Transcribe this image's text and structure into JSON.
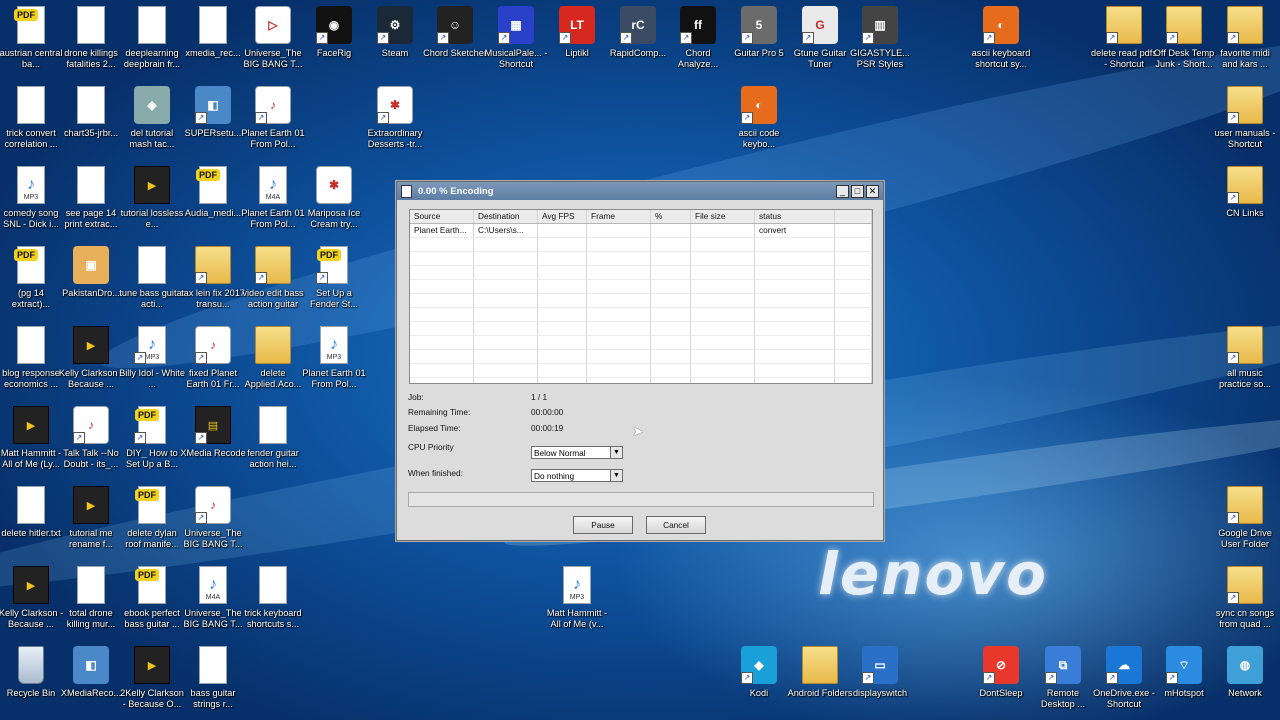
{
  "desktop": {
    "brand": "lenovo",
    "icons": [
      {
        "label": "austrian central ba...",
        "icon": "pdf-icon",
        "shortcut": false
      },
      {
        "label": "drone killings fatalities 2...",
        "icon": "document-icon",
        "shortcut": false
      },
      {
        "label": "deeplearning deepbrain fr...",
        "icon": "document-icon",
        "shortcut": false
      },
      {
        "label": "xmedia_rec...",
        "icon": "document-icon",
        "shortcut": false
      },
      {
        "label": "Universe_The BIG BANG T...",
        "icon": "media-player-icon",
        "shortcut": false
      },
      {
        "label": "FaceRig",
        "icon": "facerig-icon",
        "shortcut": true
      },
      {
        "label": "Steam",
        "icon": "steam-icon",
        "shortcut": true
      },
      {
        "label": "Chord Sketcher",
        "icon": "chord-sketcher-icon",
        "shortcut": true
      },
      {
        "label": "MusicalPale... - Shortcut",
        "icon": "musical-palette-icon",
        "shortcut": true
      },
      {
        "label": "Liptikl",
        "icon": "liptikl-icon",
        "shortcut": true
      },
      {
        "label": "RapidComp...",
        "icon": "rapidcomposer-icon",
        "shortcut": true
      },
      {
        "label": "Chord Analyze...",
        "icon": "chord-analyzer-icon",
        "shortcut": true
      },
      {
        "label": "Guitar Pro 5",
        "icon": "guitar-pro-icon",
        "shortcut": true
      },
      {
        "label": "Gtune Guitar Tuner",
        "icon": "gtune-icon",
        "shortcut": true
      },
      {
        "label": "GIGASTYLE... PSR Styles",
        "icon": "keyboard-icon",
        "shortcut": true
      },
      {
        "label": "ascii keyboard shortcut sy...",
        "icon": "firefox-icon",
        "shortcut": true
      },
      {
        "label": "delete read pdfs - Shortcut",
        "icon": "folder-icon",
        "shortcut": true
      },
      {
        "label": "Off Desk Temp Junk - Short...",
        "icon": "folder-icon",
        "shortcut": true
      },
      {
        "label": "favorite midi and kars ...",
        "icon": "folder-icon",
        "shortcut": true
      },
      {
        "label": "trick convert correlation ...",
        "icon": "document-icon",
        "shortcut": false
      },
      {
        "label": "chart35-jrbr...",
        "icon": "document-icon",
        "shortcut": false
      },
      {
        "label": "del tutorial mash tac...",
        "icon": "app-icon",
        "shortcut": false
      },
      {
        "label": "SUPERsetu...",
        "icon": "setup-icon",
        "shortcut": true
      },
      {
        "label": "Planet Earth 01 From Pol...",
        "icon": "media-file-icon",
        "shortcut": true
      },
      {
        "label": "Extraordinary Desserts -tr...",
        "icon": "yelp-icon",
        "shortcut": true
      },
      {
        "label": "ascii code keybo...",
        "icon": "firefox-icon",
        "shortcut": true
      },
      {
        "label": "user manuals - Shortcut",
        "icon": "folder-icon",
        "shortcut": true
      },
      {
        "label": "comedy song SNL - Dick i...",
        "icon": "mp3-icon",
        "shortcut": false
      },
      {
        "label": "see page 14 print extrac...",
        "icon": "document-icon",
        "shortcut": false
      },
      {
        "label": "tutorial lossless e...",
        "icon": "video-icon",
        "shortcut": false
      },
      {
        "label": "Audia_medi...",
        "icon": "pdf-icon",
        "shortcut": false
      },
      {
        "label": "Planet Earth 01 From Pol...",
        "icon": "m4a-icon",
        "shortcut": false
      },
      {
        "label": "Mariposa Ice Cream try...",
        "icon": "yelp-icon",
        "shortcut": false
      },
      {
        "label": "CN Links",
        "icon": "folder-icon",
        "shortcut": true
      },
      {
        "label": "(pg 14 extract)...",
        "icon": "pdf-icon",
        "shortcut": false
      },
      {
        "label": "PakistanDro...",
        "icon": "image-icon",
        "shortcut": false
      },
      {
        "label": "tune bass guitar acti...",
        "icon": "document-icon",
        "shortcut": false
      },
      {
        "label": "tax lein fix 2017 transu...",
        "icon": "folder-icon",
        "shortcut": true
      },
      {
        "label": "video edit bass action guitar",
        "icon": "folder-icon",
        "shortcut": true
      },
      {
        "label": "Set Up a Fender St...",
        "icon": "pdf-icon",
        "shortcut": true
      },
      {
        "label": "blog response economics ...",
        "icon": "document-icon",
        "shortcut": false
      },
      {
        "label": "Kelly Clarkson - Because ...",
        "icon": "video-icon",
        "shortcut": false
      },
      {
        "label": "Billy Idol - White ...",
        "icon": "mp3-icon",
        "shortcut": true
      },
      {
        "label": "fixed Planet Earth 01 Fr...",
        "icon": "media-file-icon",
        "shortcut": true
      },
      {
        "label": "delete Applied.Aco...",
        "icon": "folder-icon",
        "shortcut": false
      },
      {
        "label": "Planet Earth 01 From Pol...",
        "icon": "mp3-icon",
        "shortcut": false
      },
      {
        "label": "all music practice so...",
        "icon": "folder-icon",
        "shortcut": true
      },
      {
        "label": "Matt Hammitt - All of Me (Ly...",
        "icon": "video-icon",
        "shortcut": false
      },
      {
        "label": "Talk Talk --No Doubt - its_...",
        "icon": "media-file-icon",
        "shortcut": true
      },
      {
        "label": "DIY_ How to Set Up a B...",
        "icon": "pdf-icon",
        "shortcut": true
      },
      {
        "label": "XMedia Recode",
        "icon": "film-icon",
        "shortcut": true
      },
      {
        "label": "fender guitar action hei...",
        "icon": "document-icon",
        "shortcut": false
      },
      {
        "label": "delete hitler.txt",
        "icon": "document-icon",
        "shortcut": false
      },
      {
        "label": "tutorial me rename f...",
        "icon": "video-icon",
        "shortcut": false
      },
      {
        "label": "delete dylan roof manife...",
        "icon": "pdf-icon",
        "shortcut": false
      },
      {
        "label": "Universe_The BIG BANG T...",
        "icon": "media-file-icon",
        "shortcut": true
      },
      {
        "label": "Google Drive User Folder",
        "icon": "folder-icon",
        "shortcut": true
      },
      {
        "label": "Kelly Clarkson - Because ...",
        "icon": "video-icon",
        "shortcut": false
      },
      {
        "label": "total drone killing mur...",
        "icon": "document-icon",
        "shortcut": false
      },
      {
        "label": "ebook perfect bass guitar ...",
        "icon": "pdf-icon",
        "shortcut": false
      },
      {
        "label": "Universe_The BIG BANG T...",
        "icon": "m4a-icon",
        "shortcut": false
      },
      {
        "label": "trick keyboard shortcuts s...",
        "icon": "document-icon",
        "shortcut": false
      },
      {
        "label": "Matt Hammitt - All of Me (v...",
        "icon": "mp3-icon",
        "shortcut": false
      },
      {
        "label": "sync cn songs from quad ...",
        "icon": "folder-icon",
        "shortcut": true
      },
      {
        "label": "Recycle Bin",
        "icon": "recycle-bin-icon",
        "shortcut": false
      },
      {
        "label": "XMediaReco...",
        "icon": "setup-icon",
        "shortcut": false
      },
      {
        "label": "2Kelly Clarkson - Because O...",
        "icon": "video-icon",
        "shortcut": false
      },
      {
        "label": "bass guitar strings r...",
        "icon": "document-icon",
        "shortcut": false
      },
      {
        "label": "Kodi",
        "icon": "kodi-icon",
        "shortcut": true
      },
      {
        "label": "Android Folders",
        "icon": "folder-icon",
        "shortcut": false
      },
      {
        "label": "displayswitch",
        "icon": "display-switch-icon",
        "shortcut": true
      },
      {
        "label": "DontSleep",
        "icon": "dontsleep-icon",
        "shortcut": true
      },
      {
        "label": "Remote Desktop ...",
        "icon": "remote-desktop-icon",
        "shortcut": true
      },
      {
        "label": "OneDrive.exe - Shortcut",
        "icon": "onedrive-icon",
        "shortcut": true
      },
      {
        "label": "mHotspot",
        "icon": "hotspot-icon",
        "shortcut": true
      },
      {
        "label": "Network",
        "icon": "network-icon",
        "shortcut": false
      }
    ]
  },
  "dialog": {
    "title": "0.00 % Encoding",
    "controls": {
      "minimize": "_",
      "maximize": "□",
      "close": "✕"
    },
    "columns": [
      "Source",
      "Destination",
      "Avg FPS",
      "Frame",
      "%",
      "File size",
      "status",
      ""
    ],
    "rows": [
      [
        "Planet Earth...",
        "C:\\Users\\s...",
        "",
        "",
        "",
        "",
        "convert",
        ""
      ]
    ],
    "job_label": "Job:",
    "job_value": "1 / 1",
    "remaining_label": "Remaining Time:",
    "remaining_value": "00:00:00",
    "elapsed_label": "Elapsed Time:",
    "elapsed_value": "00:00:19",
    "cpu_priority_label": "CPU Priority",
    "cpu_priority_value": "Below Normal",
    "when_finished_label": "When finished:",
    "when_finished_value": "Do nothing",
    "progress_fraction": 0.0,
    "pause_label": "Pause",
    "cancel_label": "Cancel"
  },
  "colors": {
    "desktop_blue": "#0d4f9a",
    "titlebar": "#6a88ae",
    "cursor_highlight": "#ffec3c"
  }
}
